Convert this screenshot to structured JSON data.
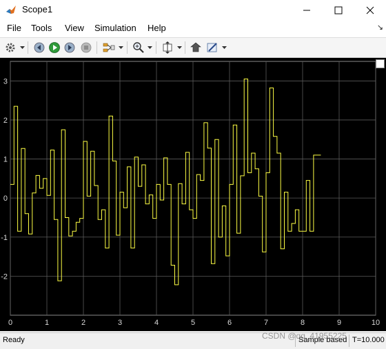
{
  "window": {
    "title": "Scope1"
  },
  "menu": {
    "items": [
      "File",
      "Tools",
      "View",
      "Simulation",
      "Help"
    ],
    "undock_glyph": "↘"
  },
  "toolbar": {
    "icons": [
      "gear-icon",
      "step-back-icon",
      "run-icon",
      "step-forward-icon",
      "stop-icon",
      "signal-selector-icon",
      "zoom-icon",
      "scale-axes-icon",
      "highlight-simulink-block-icon",
      "style-icon"
    ]
  },
  "status": {
    "ready": "Ready",
    "sample_mode": "Sample based",
    "time": "T=10.000"
  },
  "watermark": "CSDN @qq_41955225",
  "colors": {
    "trace": "#ffff44",
    "plot_bg": "#000000",
    "grid": "#5a5a5a",
    "tick_text": "#d9d9d9"
  },
  "chart_data": {
    "type": "line",
    "step": true,
    "xlim": [
      0,
      10
    ],
    "ylim": [
      -3,
      3.5
    ],
    "xticks": [
      0,
      1,
      2,
      3,
      4,
      5,
      6,
      7,
      8,
      9,
      10
    ],
    "yticks": [
      -2,
      -1,
      0,
      1,
      2,
      3
    ],
    "grid": true,
    "x": [
      0,
      0.1,
      0.2,
      0.3,
      0.4,
      0.5,
      0.6,
      0.7,
      0.8,
      0.9,
      1.0,
      1.1,
      1.2,
      1.3,
      1.4,
      1.5,
      1.6,
      1.7,
      1.8,
      1.9,
      2.0,
      2.1,
      2.2,
      2.3,
      2.4,
      2.5,
      2.6,
      2.7,
      2.8,
      2.9,
      3.0,
      3.1,
      3.2,
      3.3,
      3.4,
      3.5,
      3.6,
      3.7,
      3.8,
      3.9,
      4.0,
      4.1,
      4.2,
      4.3,
      4.4,
      4.5,
      4.6,
      4.7,
      4.8,
      4.9,
      5.0,
      5.1,
      5.2,
      5.3,
      5.4,
      5.5,
      5.6,
      5.7,
      5.8,
      5.9,
      6.0,
      6.1,
      6.2,
      6.3,
      6.4,
      6.5,
      6.6,
      6.7,
      6.8,
      6.9,
      7.0,
      7.1,
      7.2,
      7.3,
      7.4,
      7.5,
      7.6,
      7.7,
      7.8,
      7.9,
      8.0,
      8.1,
      8.2,
      8.3,
      8.4,
      8.5,
      8.6,
      8.7,
      8.8,
      8.9,
      9.0,
      9.1,
      9.2,
      9.3,
      9.4,
      9.5,
      9.6,
      9.7,
      9.8,
      9.9,
      10.0
    ],
    "y": [
      0.35,
      2.35,
      -0.85,
      1.27,
      -0.4,
      -0.92,
      0.13,
      0.58,
      0.25,
      0.5,
      0.07,
      1.23,
      -0.55,
      -2.12,
      1.75,
      -0.5,
      -0.97,
      -0.85,
      -0.62,
      -0.52,
      1.45,
      0.05,
      1.2,
      0.32,
      -0.55,
      -0.3,
      -1.28,
      2.1,
      0.95,
      -0.95,
      0.15,
      -0.25,
      0.8,
      -1.28,
      1.05,
      0.3,
      0.85,
      -0.15,
      0.08,
      -0.52,
      0.35,
      -0.05,
      1.03,
      0.35,
      -1.72,
      -2.22,
      0.37,
      -0.15,
      1.17,
      -0.3,
      -0.52,
      0.6,
      0.45,
      1.93,
      1.28,
      -1.68,
      1.5,
      -1.0,
      -0.2,
      -1.48,
      0.35,
      1.87,
      -0.9,
      0.57,
      3.05,
      0.65,
      1.15,
      0.75,
      0.05,
      -1.38,
      0.65,
      2.82,
      1.58,
      1.15,
      -1.3,
      0.15,
      -0.85,
      -0.65,
      -0.3,
      -0.85,
      -0.85,
      0.45,
      -0.85,
      1.1,
      1.1
    ]
  }
}
